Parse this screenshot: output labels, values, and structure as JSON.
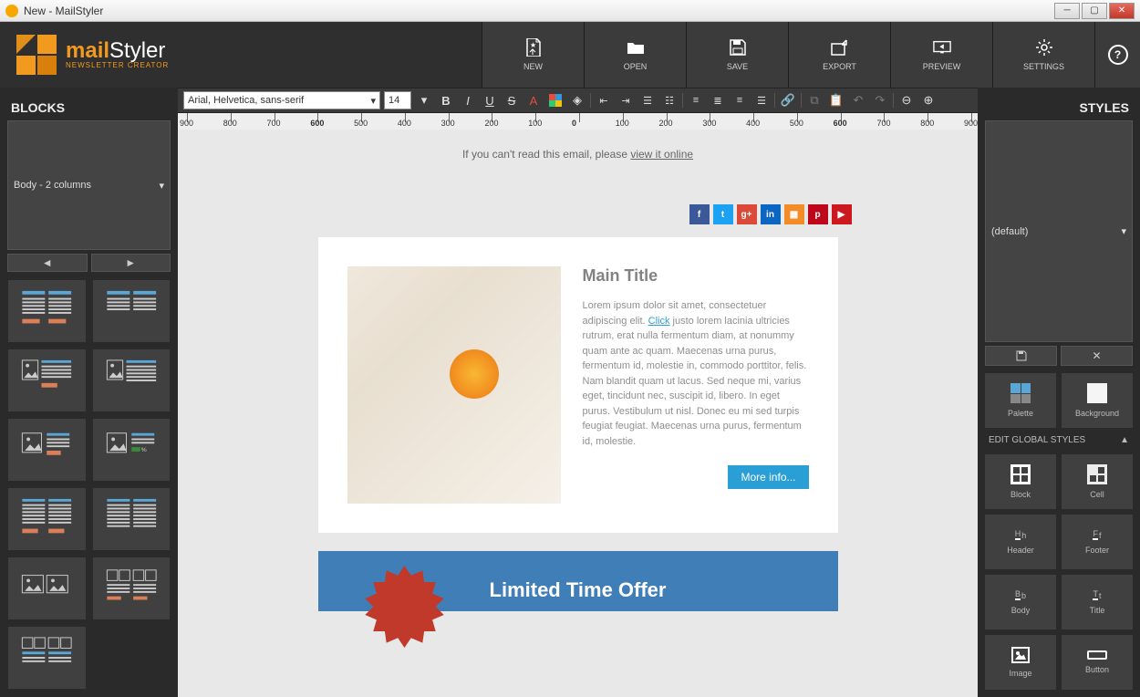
{
  "titlebar": {
    "title": "New - MailStyler"
  },
  "logo": {
    "main_a": "mail",
    "main_b": "Styler",
    "sub": "NEWSLETTER CREATOR"
  },
  "toolbar": {
    "new": "NEW",
    "open": "OPEN",
    "save": "SAVE",
    "export": "EXPORT",
    "preview": "PREVIEW",
    "settings": "SETTINGS",
    "help": "?"
  },
  "blocks": {
    "title": "BLOCKS",
    "select": "Body - 2 columns",
    "prev": "◄",
    "next": "►"
  },
  "format": {
    "font": "Arial, Helvetica, sans-serif",
    "size": "14"
  },
  "ruler": {
    "ticks": [
      "900",
      "800",
      "700",
      "600",
      "500",
      "400",
      "300",
      "200",
      "100",
      "0",
      "100",
      "200",
      "300",
      "400",
      "500",
      "600",
      "700",
      "800",
      "900"
    ]
  },
  "canvas": {
    "preheader_a": "If you can't read this email, please ",
    "preheader_link": "view it online",
    "social": [
      {
        "name": "facebook",
        "bg": "#3b5998",
        "txt": "f"
      },
      {
        "name": "twitter",
        "bg": "#1da1f2",
        "txt": "t"
      },
      {
        "name": "google",
        "bg": "#db4a39",
        "txt": "g+"
      },
      {
        "name": "linkedin",
        "bg": "#0a66c2",
        "txt": "in"
      },
      {
        "name": "rss",
        "bg": "#f28c28",
        "txt": "▦"
      },
      {
        "name": "pinterest",
        "bg": "#bd081c",
        "txt": "p"
      },
      {
        "name": "youtube",
        "bg": "#cc181e",
        "txt": "▶"
      }
    ],
    "title": "Main Title",
    "body_a": "Lorem ipsum dolor sit amet, consectetuer adipiscing elit. ",
    "body_link": "Click",
    "body_b": " justo lorem lacinia ultricies rutrum, erat nulla fermentum diam, at nonummy quam ante ac quam. Maecenas urna purus, fermentum id, molestie in, commodo porttitor, felis. Nam blandit quam ut lacus. Sed neque mi, varius eget, tincidunt nec, suscipit id, libero. In eget purus. Vestibulum ut nisl. Donec eu mi sed turpis feugiat feugiat. Maecenas urna purus, fermentum id, molestie.",
    "more": "More info...",
    "offer": "Limited Time Offer"
  },
  "styles": {
    "title": "STYLES",
    "select": "(default)",
    "save": "▮",
    "delete": "✕",
    "palette": "Palette",
    "background": "Background",
    "section": "EDIT GLOBAL STYLES",
    "block": "Block",
    "cell": "Cell",
    "header": "Header",
    "footer": "Footer",
    "body": "Body",
    "title_l": "Title",
    "image": "Image",
    "button": "Button"
  }
}
